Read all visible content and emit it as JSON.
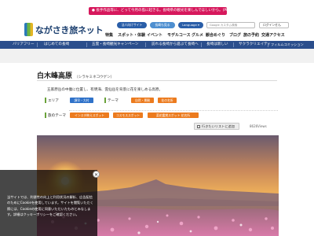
{
  "announcement": "● 長手作品等に、どって今月の島に起きる。長崎県の観光を楽しんでほしいから。(PR)",
  "header": {
    "logo_text": "ながさき旅ネット",
    "pills": [
      {
        "label": "法人向けサイト",
        "color": "#2a5ea8"
      },
      {
        "label": "長崎も見る",
        "color": "#4e8fd0"
      },
      {
        "label": "Language ▾",
        "color": "#2a5ea8"
      }
    ],
    "search_placeholder": "Google カスタム検索",
    "login_label": "ログインせん"
  },
  "gnav": {
    "items": [
      "特集",
      "スポット・体験",
      "イベント",
      "モデルコース",
      "グルメ",
      "観合めぐり",
      "ブログ",
      "旅の予約",
      "交通アクセス"
    ]
  },
  "category_bar": {
    "items": [
      "バリアフリー",
      "はじめての長崎",
      "五雲・長崎観光キャンペーン",
      "訪れる長崎から遊ぶて長崎へ",
      "長崎は新しい",
      "サクラクリエイティ",
      "フィルムコミッション"
    ]
  },
  "spot": {
    "title": "白木峰高原",
    "reading": "（シラキミネコウゲン）",
    "description": "五家原岳の中腹に位置し、有明海、雲仙岳を背景に花を楽しめる高原。",
    "area_label": "エリア",
    "area_tags": [
      "諫早・大村"
    ],
    "theme_label": "テーマ",
    "theme_tags": [
      "自然・景観",
      "花の名所"
    ],
    "journey_label": "旅のテーマ",
    "journey_tags": [
      "インスタ映えスポット",
      "コスモススポット",
      "菜花鑑賞スポット 花名所"
    ]
  },
  "actions": {
    "add_list_label": "行きたいリストに追加",
    "views": "8626Views"
  },
  "cookie": {
    "text": "当サイトでは、利便性の向上と利用状況の解析、広告配信のためにCookieを使用しています。サイトを閲覧いただく際には、Cookieの使用に同意いただいたものとみなします。詳細はクッキーポリシーをご確認ください。",
    "close_label": "✕"
  }
}
